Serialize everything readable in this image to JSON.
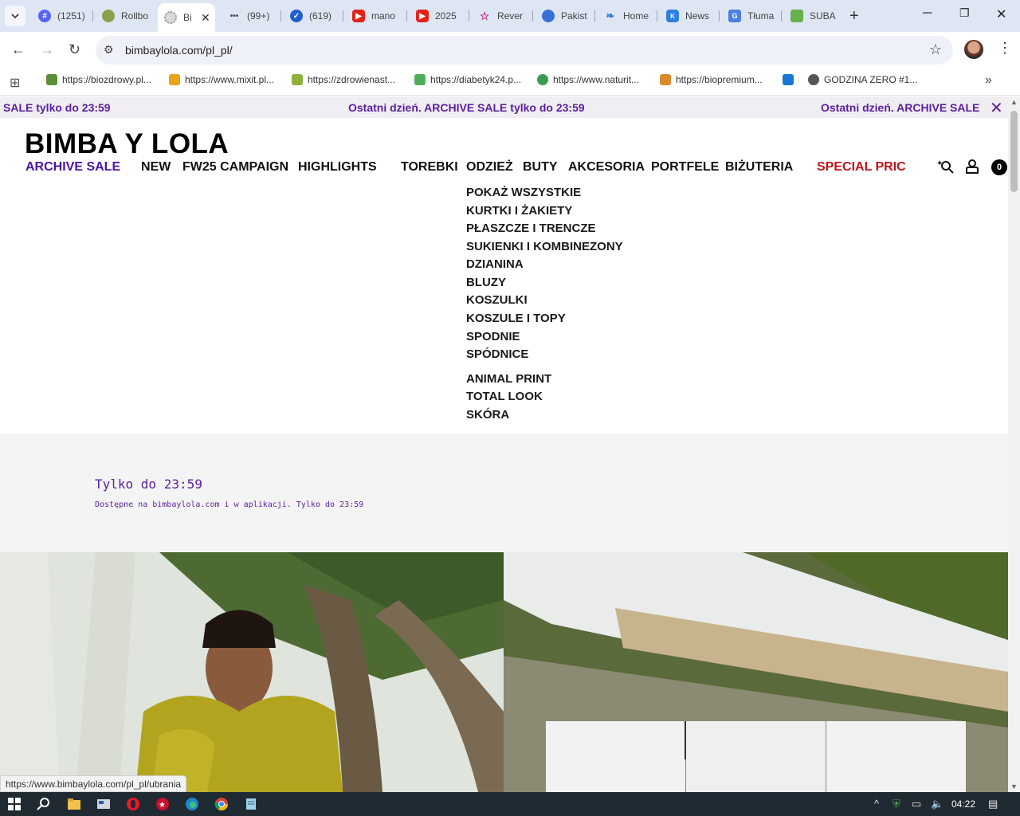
{
  "browser": {
    "tabs": [
      {
        "title": "(1251)",
        "favicon": "discord-icon",
        "color": "#5865f2"
      },
      {
        "title": "Rollbo",
        "favicon": "rollbo-icon",
        "color": "#8aa04a"
      },
      {
        "title": "Bi",
        "favicon": "bimba-icon",
        "color": "#c0c0c0",
        "active": true
      },
      {
        "title": "(99+)",
        "favicon": "dots-icon",
        "color": "#444444"
      },
      {
        "title": "(619)",
        "favicon": "check-icon",
        "color": "#1e5fcf"
      },
      {
        "title": "mano",
        "favicon": "youtube-icon",
        "color": "#e62117"
      },
      {
        "title": "2025",
        "favicon": "youtube-icon",
        "color": "#e62117"
      },
      {
        "title": "Rever",
        "favicon": "star-icon",
        "color": "#c4359a"
      },
      {
        "title": "Pakist",
        "favicon": "globe-icon",
        "color": "#3a6fd8"
      },
      {
        "title": "Home",
        "favicon": "feather-icon",
        "color": "#2a7fd9"
      },
      {
        "title": "News",
        "favicon": "vk-icon",
        "color": "#2f7fe0"
      },
      {
        "title": "Tłuma",
        "favicon": "translate-icon",
        "color": "#4b7fe0"
      },
      {
        "title": "SUBA",
        "favicon": "suba-icon",
        "color": "#66b24a"
      }
    ],
    "url": "bimbaylola.com/pl_pl/",
    "bookmarks": [
      {
        "label": "https://biozdrowy.pl...",
        "color": "#5a8f3a"
      },
      {
        "label": "https://www.mixit.pl...",
        "color": "#e8a21b"
      },
      {
        "label": "https://zdrowienast...",
        "color": "#8fb13a"
      },
      {
        "label": "https://diabetyk24.p...",
        "color": "#4fae5a"
      },
      {
        "label": "https://www.naturit...",
        "color": "#3c9b52"
      },
      {
        "label": "https://biopremium...",
        "color": "#d98a2c"
      },
      {
        "label": "",
        "color": "#1877d6"
      },
      {
        "label": "GODZINA ZERO #1...",
        "color": "#555555"
      }
    ],
    "status_url": "https://www.bimbaylola.com/pl_pl/ubrania"
  },
  "promo_bar": {
    "left": "SALE tylko do 23:59",
    "center": "Ostatni dzień. ARCHIVE SALE tylko do 23:59",
    "right": "Ostatni dzień. ARCHIVE SALE"
  },
  "brand": {
    "logo": "BIMBA Y LOLA"
  },
  "nav": [
    "ARCHIVE SALE",
    "NEW",
    "FW25 CAMPAIGN",
    "HIGHLIGHTS",
    "TOREBKI",
    "ODZIEŻ",
    "BUTY",
    "AKCESORIA",
    "PORTFELE",
    "BIŻUTERIA",
    "SPECIAL PRIC"
  ],
  "cart_count": "0",
  "dropdown": {
    "group1": [
      "POKAŻ WSZYSTKIE",
      "KURTKI I ŻAKIETY",
      "PŁASZCZE I TRENCZE",
      "SUKIENKI I KOMBINEZONY",
      "DZIANINA",
      "BLUZY",
      "KOSZULKI",
      "KOSZULE I TOPY",
      "SPODNIE",
      "SPÓDNICE"
    ],
    "group2": [
      "ANIMAL PRINT",
      "TOTAL LOOK",
      "SKÓRA"
    ]
  },
  "promo_block": {
    "heading": "Tylko do 23:59",
    "subtext": "Dostępne na bimbaylola.com i w aplikacji. Tylko do 23:59"
  },
  "taskbar": {
    "time": "04:22"
  },
  "colors": {
    "accent_purple": "#4b14a8",
    "special_red": "#c0161c"
  }
}
